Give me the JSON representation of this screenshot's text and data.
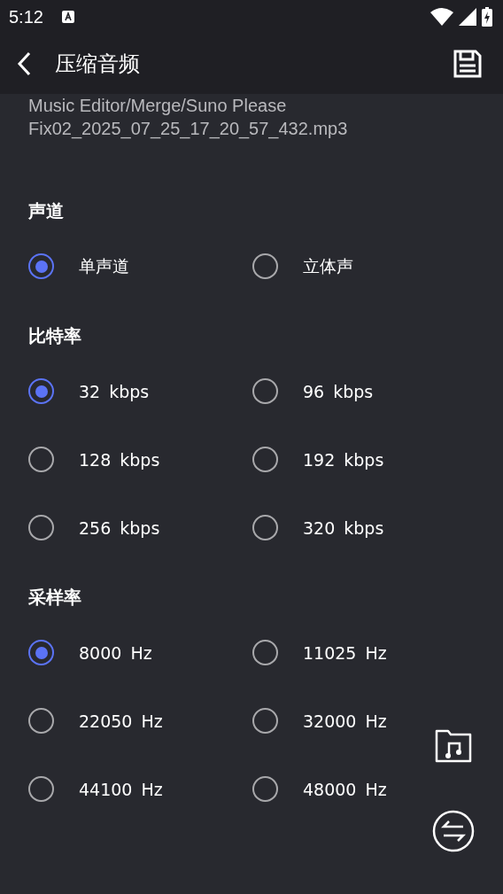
{
  "status_bar": {
    "time": "5:12"
  },
  "app_bar": {
    "title": "压缩音频"
  },
  "file_path": "Music Editor/Merge/Suno Please Fix02_2025_07_25_17_20_57_432.mp3",
  "sections": [
    {
      "heading": "声道",
      "options": [
        {
          "label": "单声道",
          "selected": true
        },
        {
          "label": "立体声",
          "selected": false
        }
      ]
    },
    {
      "heading": "比特率",
      "options": [
        {
          "label": "32 kbps",
          "selected": true
        },
        {
          "label": "96 kbps",
          "selected": false
        },
        {
          "label": "128 kbps",
          "selected": false
        },
        {
          "label": "192 kbps",
          "selected": false
        },
        {
          "label": "256 kbps",
          "selected": false
        },
        {
          "label": "320 kbps",
          "selected": false
        }
      ]
    },
    {
      "heading": "采样率",
      "options": [
        {
          "label": "8000 Hz",
          "selected": true
        },
        {
          "label": "11025 Hz",
          "selected": false
        },
        {
          "label": "22050 Hz",
          "selected": false
        },
        {
          "label": "32000 Hz",
          "selected": false
        },
        {
          "label": "44100 Hz",
          "selected": false
        },
        {
          "label": "48000 Hz",
          "selected": false
        }
      ]
    }
  ]
}
